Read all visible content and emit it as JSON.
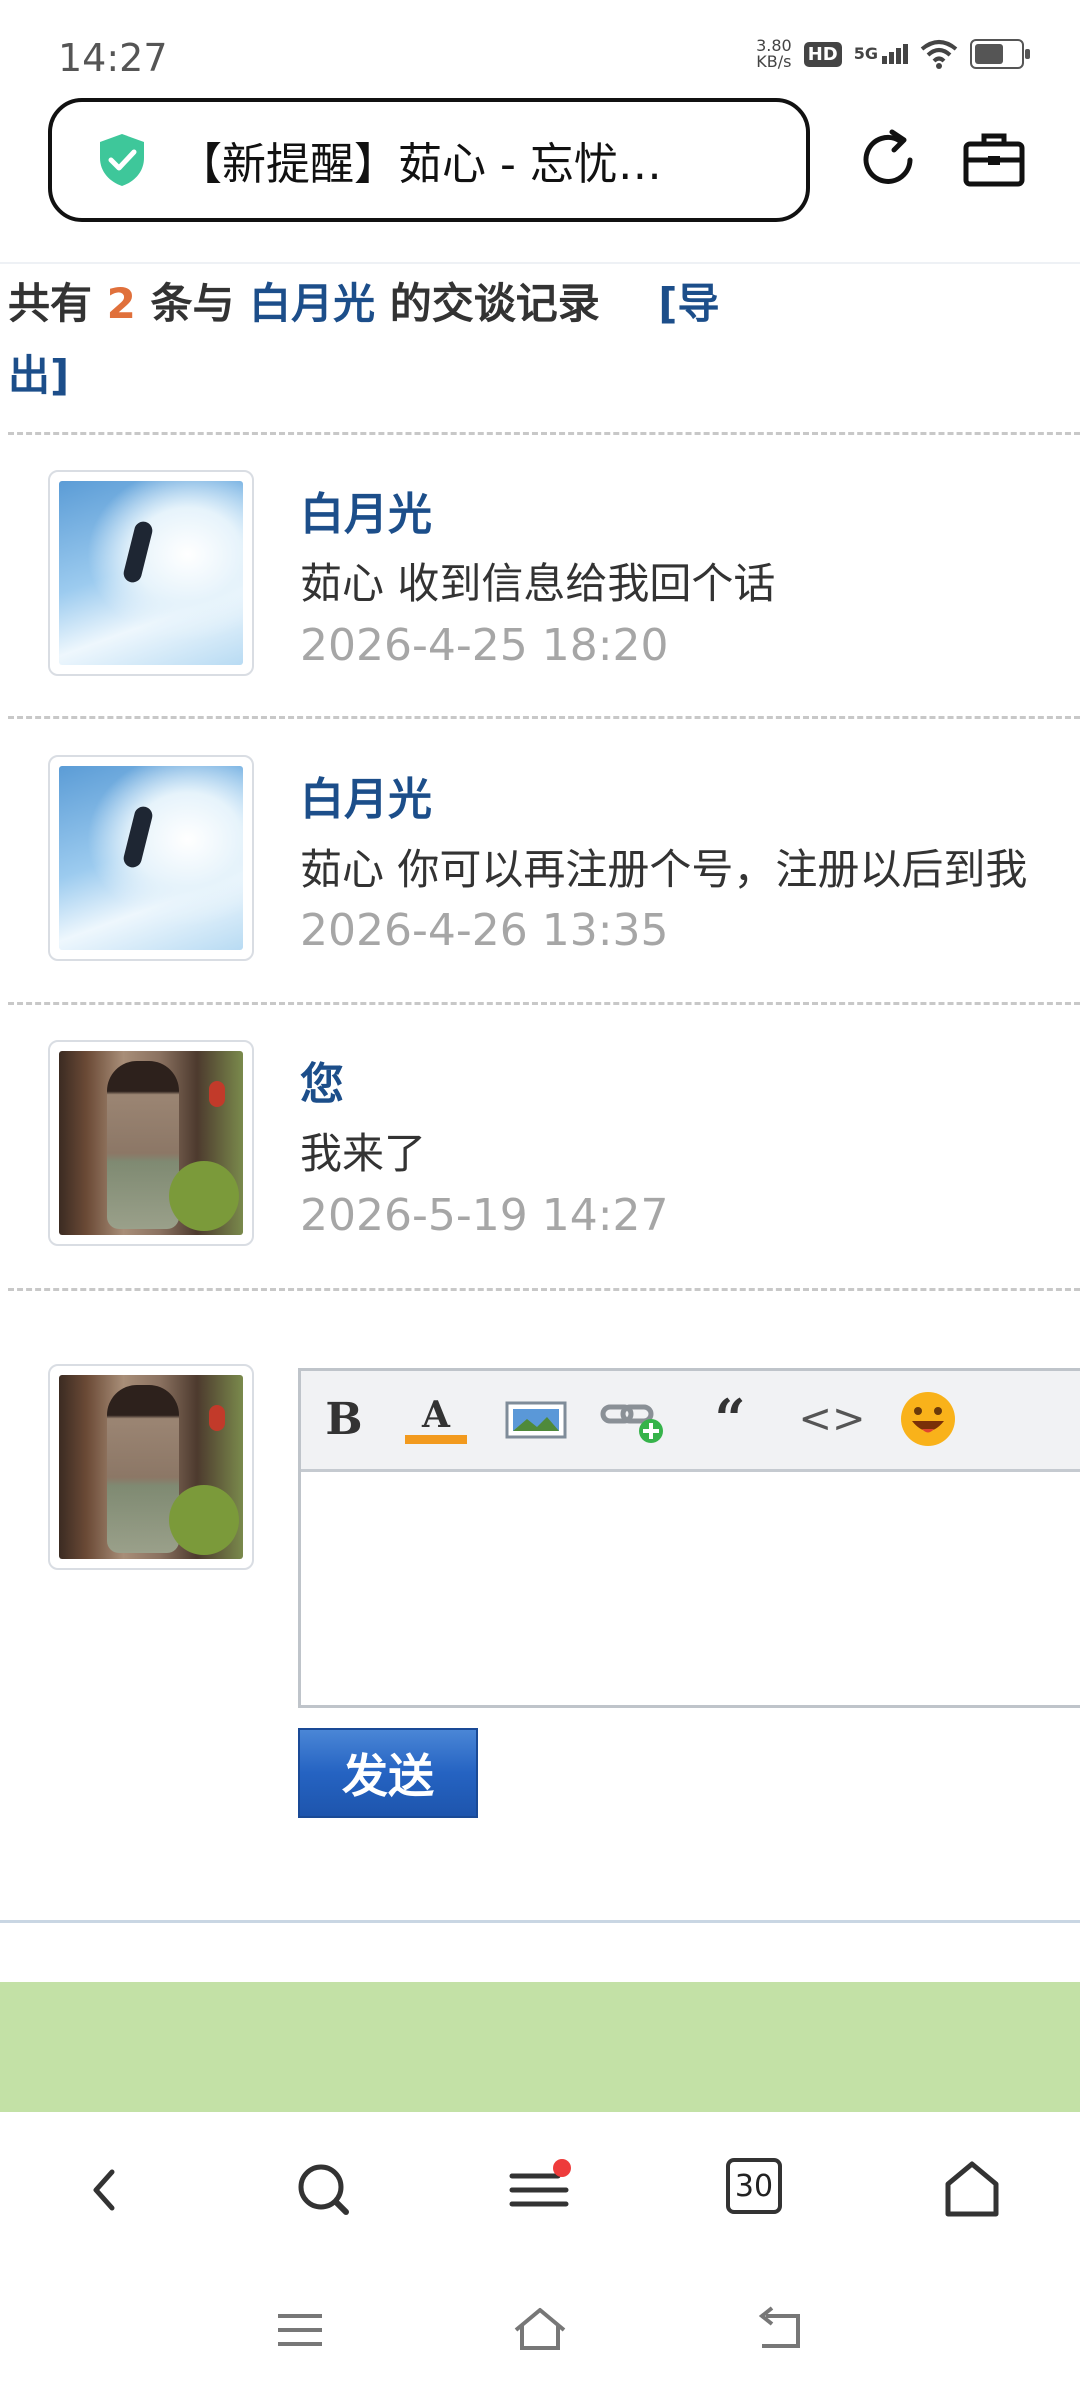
{
  "status_bar": {
    "time": "14:27",
    "net_speed_value": "3.80",
    "net_speed_unit": "KB/s",
    "hd_badge": "HD",
    "network": "5G",
    "icons": [
      "hd-icon",
      "signal-5g-icon",
      "wifi-icon",
      "battery-icon"
    ]
  },
  "browser": {
    "page_title": "【新提醒】茹心 - 忘忧…",
    "icons": [
      "security-shield-icon",
      "reload-icon",
      "briefcase-icon"
    ]
  },
  "conversation": {
    "prefix": "共有",
    "count": "2",
    "middle": "条与",
    "partner": "白月光",
    "suffix": "的交谈记录",
    "export_link": "[导出]"
  },
  "messages": [
    {
      "sender": "白月光",
      "text": "茹心 收到信息给我回个话",
      "time": "2026-4-25 18:20"
    },
    {
      "sender": "白月光",
      "text": "茹心 你可以再注册个号，注册以后到我",
      "time": "2026-4-26 13:35"
    },
    {
      "sender": "您",
      "text": "我来了",
      "time": "2026-5-19 14:27"
    }
  ],
  "editor": {
    "toolbar": {
      "bold": "B",
      "font_color": "A",
      "quote": "“",
      "code": "<>"
    },
    "content": "",
    "send_label": "发送"
  },
  "browser_nav": {
    "tab_count": "30",
    "icons": [
      "back-icon",
      "search-icon",
      "menu-icon",
      "tabs-icon",
      "home-icon"
    ]
  },
  "colors": {
    "link_blue": "#1c4e8a",
    "count_orange": "#e0703b",
    "timestamp_gray": "#a6a6a6",
    "send_button_blue": "#2563c2",
    "green_bar": "#c3e1a6",
    "notification_dot": "#ee3b3b"
  }
}
